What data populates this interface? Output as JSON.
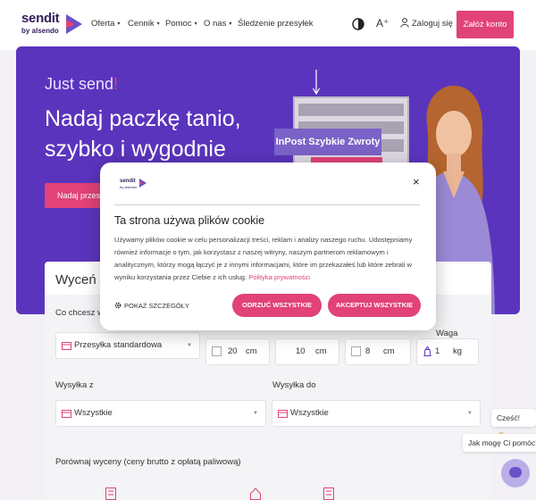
{
  "header": {
    "logo_name": "sendit",
    "logo_sub": "by alsendo",
    "nav": [
      {
        "label": "Oferta",
        "caret": "▾"
      },
      {
        "label": "Cennik",
        "caret": "▾"
      },
      {
        "label": "Pomoc",
        "caret": "▾"
      },
      {
        "label": "O nas",
        "caret": "▾"
      },
      {
        "label": "Śledzenie przesyłek",
        "caret": ""
      }
    ],
    "font_size_label": "A⁺",
    "login_label": "Zaloguj się",
    "register_label": "Załóż konto"
  },
  "hero": {
    "tag": "Just send",
    "tag_dot": "!",
    "headline_1": "Nadaj paczkę tanio,",
    "headline_2": "szybko i wygodnie",
    "cta_label": "Nadaj przesyłkę",
    "sign_label": "InPost Szybkie Zwroty"
  },
  "calculator": {
    "title": "Wyceń przesyłkę",
    "question": "Co chcesz wysłać?",
    "shipment_type": "Przesyłka standardowa",
    "weight_label": "Waga",
    "dims": [
      {
        "value": "20",
        "unit": "cm"
      },
      {
        "value": "10",
        "unit": "cm"
      },
      {
        "value": "8",
        "unit": "cm"
      },
      {
        "value": "1",
        "unit": "kg"
      }
    ],
    "from_label": "Wysyłka z",
    "from_value": "Wszystkie",
    "to_label": "Wysyłka do",
    "to_value": "Wszystkie",
    "compare_label": "Porównaj wyceny (ceny brutto z opłatą paliwową)"
  },
  "chat": {
    "greeting": "Cześć! 👋",
    "question": "Jak mogę Ci pomóc?"
  },
  "cookie": {
    "logo_name": "sendit",
    "logo_sub": "by alsendo",
    "close": "×",
    "title": "Ta strona używa plików cookie",
    "body": "Używamy plików cookie w celu personalizacji treści, reklam i analizy naszego ruchu. Udostępniamy również informacje o tym, jak korzystasz z naszej witryny, naszym partnerom reklamowym i analitycznym, którzy mogą łączyć je z innymi informacjami, które im przekazałeś lub które zebrali w wyniku korzystania przez Ciebie z ich usług.",
    "privacy_link": "Polityka prywatności",
    "details_label": "POKAŻ SZCZEGÓŁY",
    "reject_label": "ODRZUĆ WSZYSTKIE",
    "accept_label": "AKCEPTUJ WSZYSTKIE"
  },
  "colors": {
    "brand_purple": "#5b34bd",
    "accent_pink": "#e14277",
    "logo_navy": "#35205c"
  }
}
